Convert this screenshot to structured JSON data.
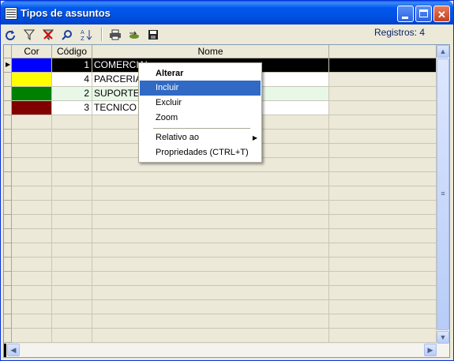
{
  "window": {
    "title": "Tipos de assuntos"
  },
  "toolbar": {
    "tools": [
      "refresh-icon",
      "filter-icon",
      "clear-filter-icon",
      "search-icon",
      "sort-az-icon",
      "print-icon",
      "export-icon",
      "save-icon"
    ],
    "records_label": "Registros: 4"
  },
  "grid": {
    "columns": [
      "Cor",
      "Código",
      "Nome"
    ],
    "rows": [
      {
        "color": "#0000ff",
        "code": "1",
        "name": "COMERCIAL",
        "selected": true
      },
      {
        "color": "#ffff00",
        "code": "4",
        "name": "PARCERIA"
      },
      {
        "color": "#008000",
        "code": "2",
        "name": "SUPORTE"
      },
      {
        "color": "#800000",
        "code": "3",
        "name": "TECNICO"
      }
    ]
  },
  "context_menu": {
    "items": [
      {
        "label": "Alterar",
        "bold": true
      },
      {
        "label": "Incluir",
        "highlighted": true
      },
      {
        "label": "Excluir"
      },
      {
        "label": "Zoom"
      },
      {
        "label": "Relativo ao",
        "submenu": true
      },
      {
        "label": "Propriedades (CTRL+T)"
      }
    ]
  },
  "colors": {
    "selection": "#000000",
    "highlight": "#316ac5",
    "alt_row": "#e8f8e8"
  }
}
